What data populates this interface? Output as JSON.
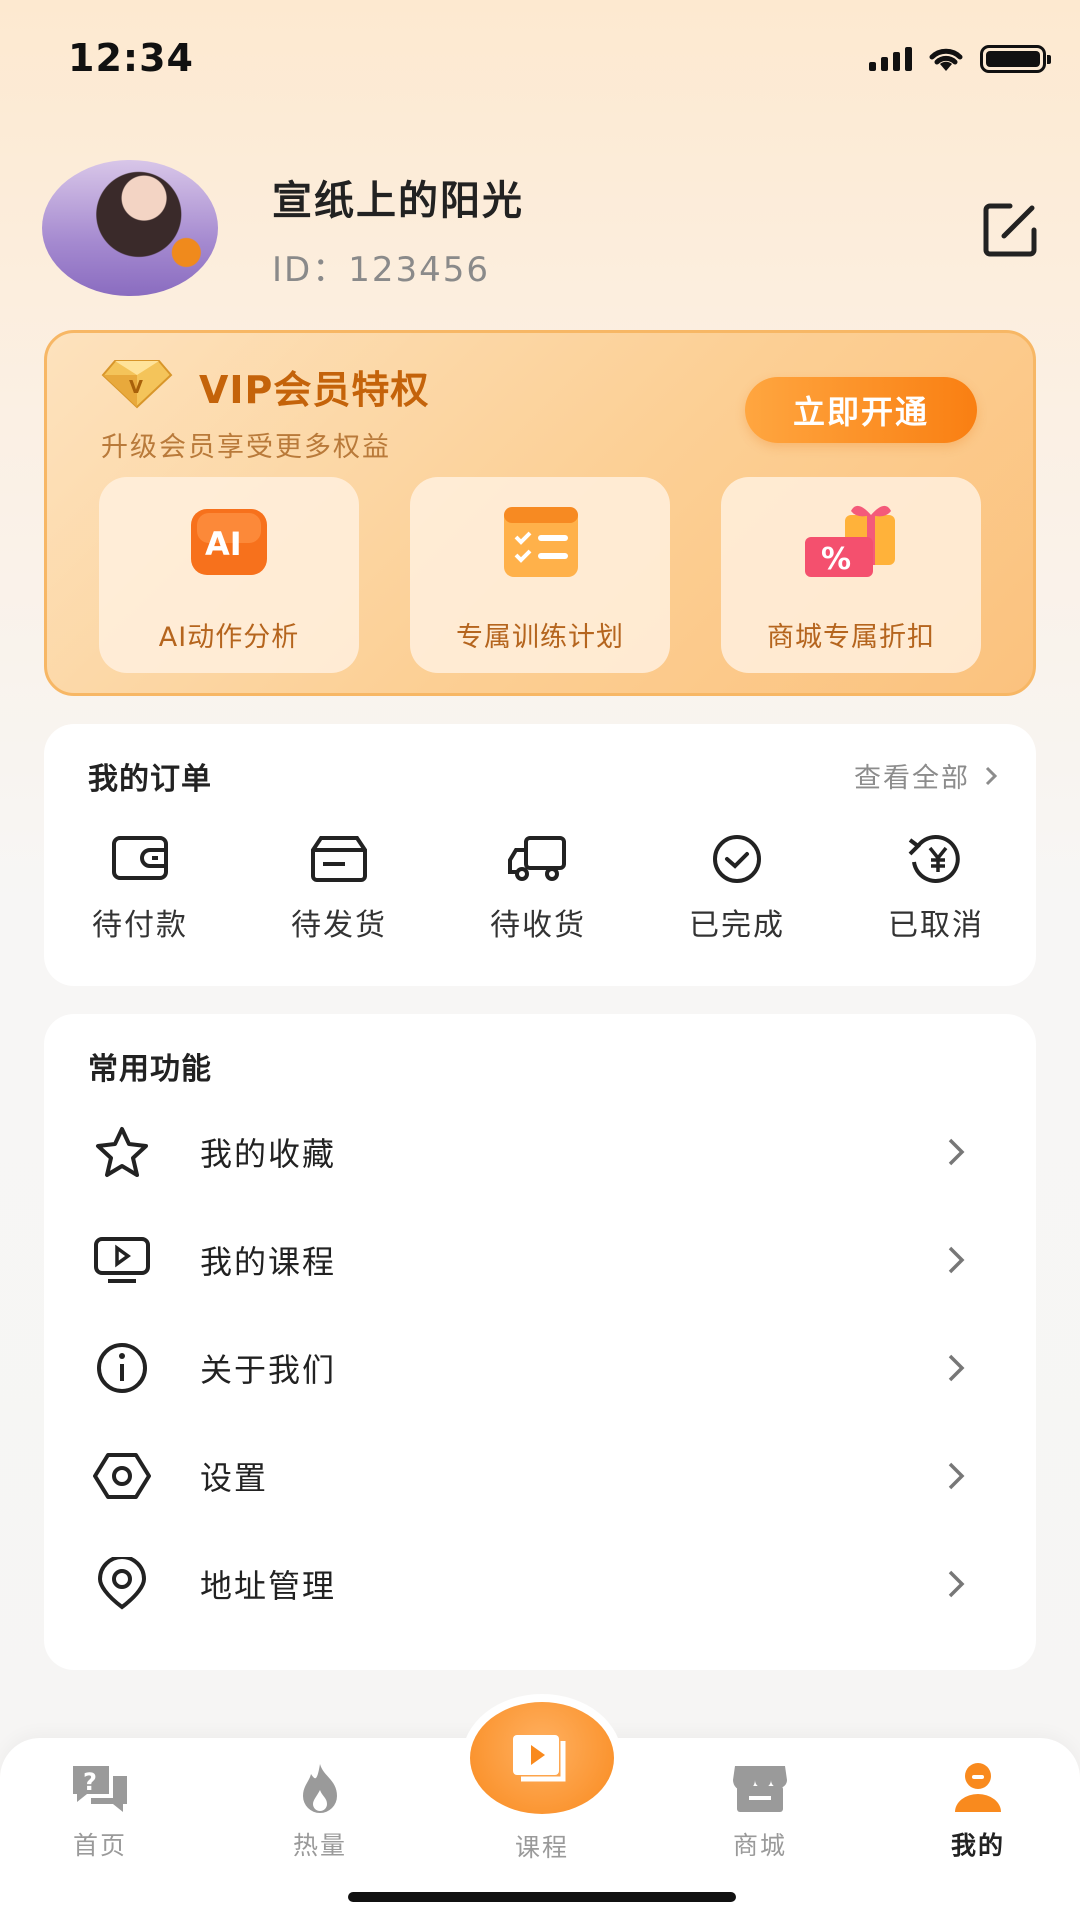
{
  "status_bar": {
    "time": "12:34"
  },
  "profile": {
    "username": "宣纸上的阳光",
    "user_id": "ID：123456"
  },
  "vip": {
    "title": "VIP会员特权",
    "subtitle": "升级会员享受更多权益",
    "open_button": "立即开通",
    "benefits": [
      {
        "label": "AI动作分析",
        "icon": "ai-icon"
      },
      {
        "label": "专属训练计划",
        "icon": "training-plan-icon"
      },
      {
        "label": "商城专属折扣",
        "icon": "discount-gift-icon"
      }
    ]
  },
  "orders": {
    "title": "我的订单",
    "view_all": "查看全部",
    "items": [
      {
        "label": "待付款",
        "icon": "wallet-icon"
      },
      {
        "label": "待发货",
        "icon": "card-icon"
      },
      {
        "label": "待收货",
        "icon": "truck-icon"
      },
      {
        "label": "已完成",
        "icon": "check-circle-icon"
      },
      {
        "label": "已取消",
        "icon": "refund-yen-icon"
      }
    ]
  },
  "features": {
    "title": "常用功能",
    "items": [
      {
        "label": "我的收藏",
        "icon": "star-icon"
      },
      {
        "label": "我的课程",
        "icon": "video-screen-icon"
      },
      {
        "label": "关于我们",
        "icon": "info-icon"
      },
      {
        "label": "设置",
        "icon": "settings-hex-icon"
      },
      {
        "label": "地址管理",
        "icon": "location-pin-icon"
      }
    ]
  },
  "bottom_nav": {
    "items": [
      {
        "label": "首页",
        "icon": "question-chat-icon"
      },
      {
        "label": "热量",
        "icon": "flame-icon"
      },
      {
        "label": "课程",
        "icon": "course-play-icon"
      },
      {
        "label": "商城",
        "icon": "store-icon"
      },
      {
        "label": "我的",
        "icon": "user-icon"
      }
    ],
    "active": "我的"
  },
  "colors": {
    "accent": "#f98a1e",
    "vip_text": "#c4630a",
    "vip_bg": "#fccf94"
  }
}
